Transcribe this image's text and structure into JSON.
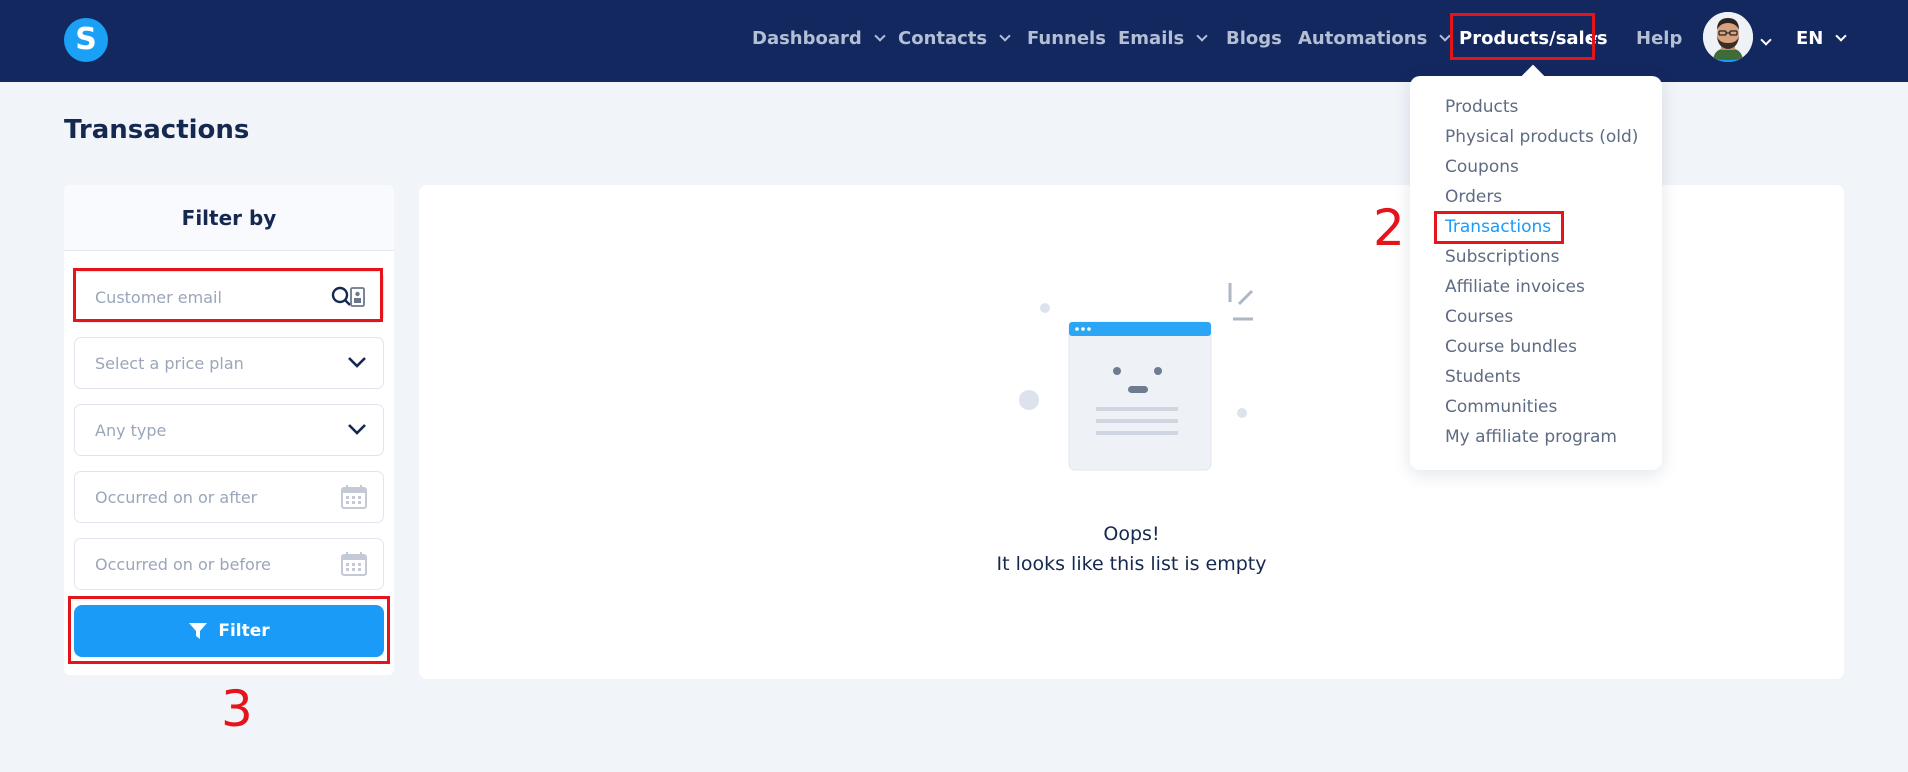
{
  "brand": {
    "logo_letter": "S",
    "accent": "#1a9bf7",
    "nav_bg": "#13285f",
    "highlight": "#e5141b"
  },
  "nav": {
    "dashboard": "Dashboard",
    "contacts": "Contacts",
    "funnels": "Funnels",
    "emails": "Emails",
    "blogs": "Blogs",
    "automations": "Automations",
    "products_sales": "Products/sales",
    "help": "Help",
    "language": "EN"
  },
  "page": {
    "title": "Transactions"
  },
  "filter": {
    "heading": "Filter by",
    "email_placeholder": "Customer email",
    "price_plan_placeholder": "Select a price plan",
    "type_placeholder": "Any type",
    "after_placeholder": "Occurred on or after",
    "before_placeholder": "Occurred on or before",
    "button_label": "Filter"
  },
  "empty_state": {
    "title": "Oops!",
    "message": "It looks like this list is empty"
  },
  "dropdown": {
    "items": [
      "Products",
      "Physical products (old)",
      "Coupons",
      "Orders",
      "Transactions",
      "Subscriptions",
      "Affiliate invoices",
      "Courses",
      "Course bundles",
      "Students",
      "Communities",
      "My affiliate program"
    ],
    "active_index": 4
  },
  "annotations": {
    "step_2": "2",
    "step_3": "3"
  }
}
